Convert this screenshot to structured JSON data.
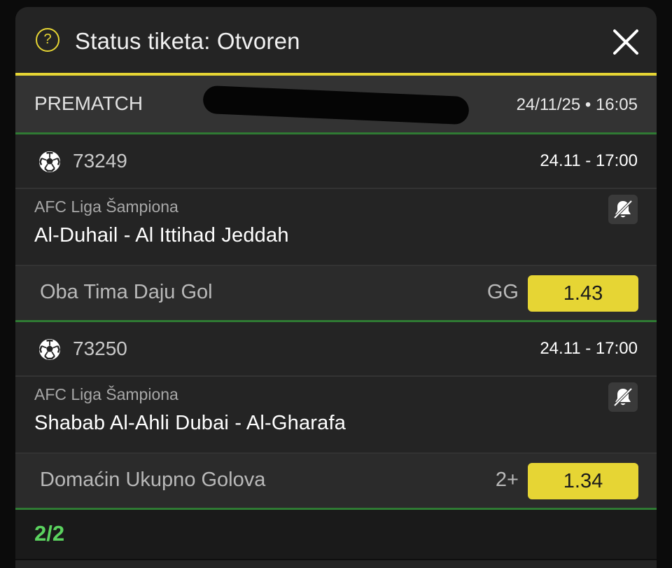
{
  "header": {
    "help_icon": "?",
    "title": "Status tiketa: Otvoren"
  },
  "info": {
    "mode": "PREMATCH",
    "ticket_id_visible": "ID",
    "date": "24/11/25 • 16:05"
  },
  "events": [
    {
      "code": "73249",
      "time": "24.11  -  17:00",
      "league": "AFC Liga Šampiona",
      "match": "Al-Duhail - Al Ittihad Jeddah",
      "market": "Oba Tima Daju Gol",
      "selection": "GG",
      "odds": "1.43"
    },
    {
      "code": "73250",
      "time": "24.11  -  17:00",
      "league": "AFC Liga Šampiona",
      "match": "Shabab Al-Ahli Dubai - Al-Gharafa",
      "market": "Domaćin Ukupno Golova",
      "selection": "2+",
      "odds": "1.34"
    }
  ],
  "footer": {
    "count": "2/2"
  },
  "colors": {
    "accent": "#e6d534",
    "success": "#5bd35f",
    "divider_green": "#2f7a33",
    "panel": "#242424",
    "background": "#0b0b0b"
  },
  "icons": [
    "help-icon",
    "close-icon",
    "soccer-ball-icon",
    "bell-off-icon"
  ]
}
